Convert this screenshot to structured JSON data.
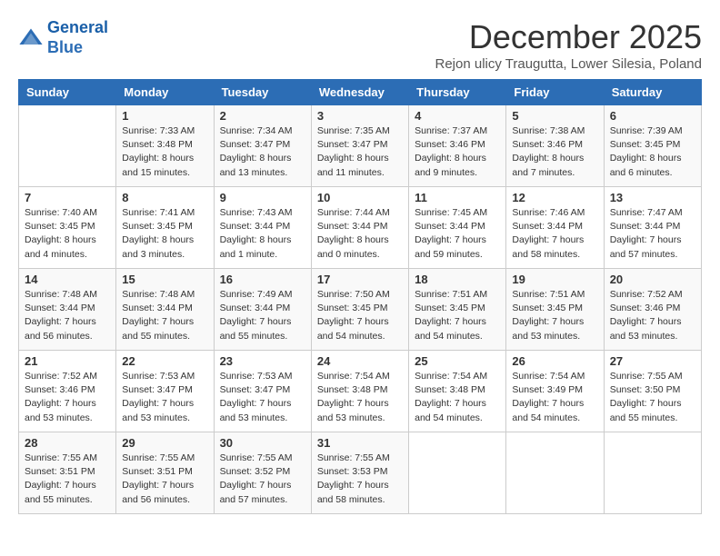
{
  "logo": {
    "line1": "General",
    "line2": "Blue"
  },
  "title": "December 2025",
  "subtitle": "Rejon ulicy Traugutta, Lower Silesia, Poland",
  "headers": [
    "Sunday",
    "Monday",
    "Tuesday",
    "Wednesday",
    "Thursday",
    "Friday",
    "Saturday"
  ],
  "weeks": [
    [
      {
        "day": "",
        "info": ""
      },
      {
        "day": "1",
        "info": "Sunrise: 7:33 AM\nSunset: 3:48 PM\nDaylight: 8 hours\nand 15 minutes."
      },
      {
        "day": "2",
        "info": "Sunrise: 7:34 AM\nSunset: 3:47 PM\nDaylight: 8 hours\nand 13 minutes."
      },
      {
        "day": "3",
        "info": "Sunrise: 7:35 AM\nSunset: 3:47 PM\nDaylight: 8 hours\nand 11 minutes."
      },
      {
        "day": "4",
        "info": "Sunrise: 7:37 AM\nSunset: 3:46 PM\nDaylight: 8 hours\nand 9 minutes."
      },
      {
        "day": "5",
        "info": "Sunrise: 7:38 AM\nSunset: 3:46 PM\nDaylight: 8 hours\nand 7 minutes."
      },
      {
        "day": "6",
        "info": "Sunrise: 7:39 AM\nSunset: 3:45 PM\nDaylight: 8 hours\nand 6 minutes."
      }
    ],
    [
      {
        "day": "7",
        "info": "Sunrise: 7:40 AM\nSunset: 3:45 PM\nDaylight: 8 hours\nand 4 minutes."
      },
      {
        "day": "8",
        "info": "Sunrise: 7:41 AM\nSunset: 3:45 PM\nDaylight: 8 hours\nand 3 minutes."
      },
      {
        "day": "9",
        "info": "Sunrise: 7:43 AM\nSunset: 3:44 PM\nDaylight: 8 hours\nand 1 minute."
      },
      {
        "day": "10",
        "info": "Sunrise: 7:44 AM\nSunset: 3:44 PM\nDaylight: 8 hours\nand 0 minutes."
      },
      {
        "day": "11",
        "info": "Sunrise: 7:45 AM\nSunset: 3:44 PM\nDaylight: 7 hours\nand 59 minutes."
      },
      {
        "day": "12",
        "info": "Sunrise: 7:46 AM\nSunset: 3:44 PM\nDaylight: 7 hours\nand 58 minutes."
      },
      {
        "day": "13",
        "info": "Sunrise: 7:47 AM\nSunset: 3:44 PM\nDaylight: 7 hours\nand 57 minutes."
      }
    ],
    [
      {
        "day": "14",
        "info": "Sunrise: 7:48 AM\nSunset: 3:44 PM\nDaylight: 7 hours\nand 56 minutes."
      },
      {
        "day": "15",
        "info": "Sunrise: 7:48 AM\nSunset: 3:44 PM\nDaylight: 7 hours\nand 55 minutes."
      },
      {
        "day": "16",
        "info": "Sunrise: 7:49 AM\nSunset: 3:44 PM\nDaylight: 7 hours\nand 55 minutes."
      },
      {
        "day": "17",
        "info": "Sunrise: 7:50 AM\nSunset: 3:45 PM\nDaylight: 7 hours\nand 54 minutes."
      },
      {
        "day": "18",
        "info": "Sunrise: 7:51 AM\nSunset: 3:45 PM\nDaylight: 7 hours\nand 54 minutes."
      },
      {
        "day": "19",
        "info": "Sunrise: 7:51 AM\nSunset: 3:45 PM\nDaylight: 7 hours\nand 53 minutes."
      },
      {
        "day": "20",
        "info": "Sunrise: 7:52 AM\nSunset: 3:46 PM\nDaylight: 7 hours\nand 53 minutes."
      }
    ],
    [
      {
        "day": "21",
        "info": "Sunrise: 7:52 AM\nSunset: 3:46 PM\nDaylight: 7 hours\nand 53 minutes."
      },
      {
        "day": "22",
        "info": "Sunrise: 7:53 AM\nSunset: 3:47 PM\nDaylight: 7 hours\nand 53 minutes."
      },
      {
        "day": "23",
        "info": "Sunrise: 7:53 AM\nSunset: 3:47 PM\nDaylight: 7 hours\nand 53 minutes."
      },
      {
        "day": "24",
        "info": "Sunrise: 7:54 AM\nSunset: 3:48 PM\nDaylight: 7 hours\nand 53 minutes."
      },
      {
        "day": "25",
        "info": "Sunrise: 7:54 AM\nSunset: 3:48 PM\nDaylight: 7 hours\nand 54 minutes."
      },
      {
        "day": "26",
        "info": "Sunrise: 7:54 AM\nSunset: 3:49 PM\nDaylight: 7 hours\nand 54 minutes."
      },
      {
        "day": "27",
        "info": "Sunrise: 7:55 AM\nSunset: 3:50 PM\nDaylight: 7 hours\nand 55 minutes."
      }
    ],
    [
      {
        "day": "28",
        "info": "Sunrise: 7:55 AM\nSunset: 3:51 PM\nDaylight: 7 hours\nand 55 minutes."
      },
      {
        "day": "29",
        "info": "Sunrise: 7:55 AM\nSunset: 3:51 PM\nDaylight: 7 hours\nand 56 minutes."
      },
      {
        "day": "30",
        "info": "Sunrise: 7:55 AM\nSunset: 3:52 PM\nDaylight: 7 hours\nand 57 minutes."
      },
      {
        "day": "31",
        "info": "Sunrise: 7:55 AM\nSunset: 3:53 PM\nDaylight: 7 hours\nand 58 minutes."
      },
      {
        "day": "",
        "info": ""
      },
      {
        "day": "",
        "info": ""
      },
      {
        "day": "",
        "info": ""
      }
    ]
  ]
}
